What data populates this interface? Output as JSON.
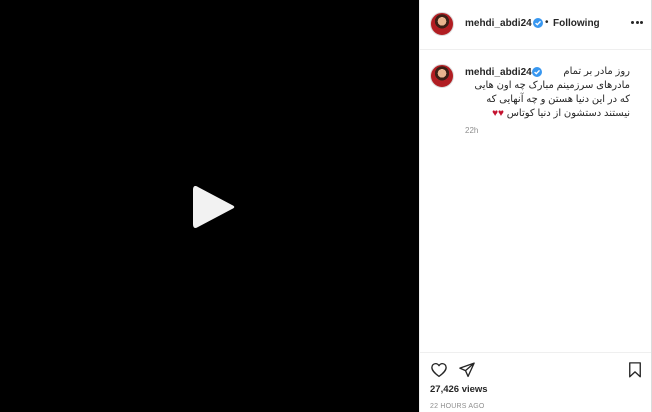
{
  "video": {
    "play_icon": "play-icon"
  },
  "header": {
    "username": "mehdi_abdi24",
    "separator": "•",
    "follow_status": "Following",
    "verified_icon": "verified-badge-icon",
    "more_icon": "more-options-icon"
  },
  "comment": {
    "username": "mehdi_abdi24",
    "caption_lines": [
      "روز مادر بر تمام",
      "مادرهای سرزمینم مبارک چه اون هایی",
      "که در این دنیا هستن و چه آنهایی که",
      "نیستند دستشون از دنیا کوتاس"
    ],
    "hearts": "♥♥",
    "time_ago": "22h"
  },
  "actions": {
    "like_icon": "heart-icon",
    "share_icon": "paper-plane-icon",
    "save_icon": "bookmark-icon"
  },
  "stats": {
    "views": "27,426 views",
    "posted": "22 HOURS AGO"
  },
  "colors": {
    "video_bg": "#000000",
    "verified": "#3897f0",
    "hearts": "#c4122f",
    "muted_text": "#8e8e8e"
  }
}
